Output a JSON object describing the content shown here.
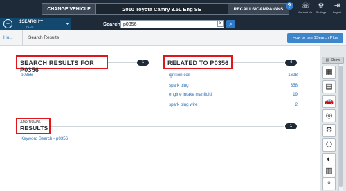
{
  "topbar": {
    "change_vehicle": "CHANGE VEHICLE",
    "vehicle": "2010 Toyota Camry 3.5L Eng SE",
    "recalls": "RECALLS/CAMPAIGNS",
    "icons": [
      {
        "name": "help-icon",
        "glyph": "?",
        "label": ""
      },
      {
        "name": "contact-us-icon",
        "glyph": "☏",
        "label": "Contact Us"
      },
      {
        "name": "settings-icon",
        "glyph": "⚙",
        "label": "Settings"
      },
      {
        "name": "logout-icon",
        "glyph": "⇥",
        "label": "Logout"
      }
    ]
  },
  "searchbar": {
    "brand": "1SEARCH™",
    "brand_sub": "PLUS",
    "label": "Search",
    "value": "p0356",
    "clear": "✕",
    "go": "⌕"
  },
  "breadcrumb": {
    "home": "Ho...",
    "current": "Search Results",
    "help_button": "How to use 1Search Plus"
  },
  "search_results": {
    "title": "SEARCH RESULTS FOR P0356",
    "count": "1",
    "items": [
      "p0356"
    ]
  },
  "related": {
    "title": "RELATED TO P0356",
    "count": "4",
    "items": [
      {
        "label": "ignition coil",
        "count": "1698"
      },
      {
        "label": "spark plug",
        "count": "358"
      },
      {
        "label": "engine intake manifold",
        "count": "19"
      },
      {
        "label": "spark plug wire",
        "count": "2"
      }
    ]
  },
  "additional": {
    "small": "ADDITIONAL",
    "title": "RESULTS",
    "count": "1",
    "items": [
      "Keyword Search - p0356"
    ]
  },
  "rightpanel": {
    "show_label": "Show",
    "icons": [
      {
        "name": "fuse-box-icon",
        "glyph": "▦"
      },
      {
        "name": "document-icon",
        "glyph": "▤"
      },
      {
        "name": "car-icon",
        "glyph": "🚗"
      },
      {
        "name": "tire-pressure-icon",
        "glyph": "◎"
      },
      {
        "name": "engine-icon",
        "glyph": "⚙"
      },
      {
        "name": "power-icon",
        "glyph": "⏻"
      },
      {
        "name": "warning-light-icon",
        "glyph": "◐"
      },
      {
        "name": "connector-icon",
        "glyph": "▥"
      },
      {
        "name": "location-icon",
        "glyph": "⌖"
      }
    ]
  }
}
